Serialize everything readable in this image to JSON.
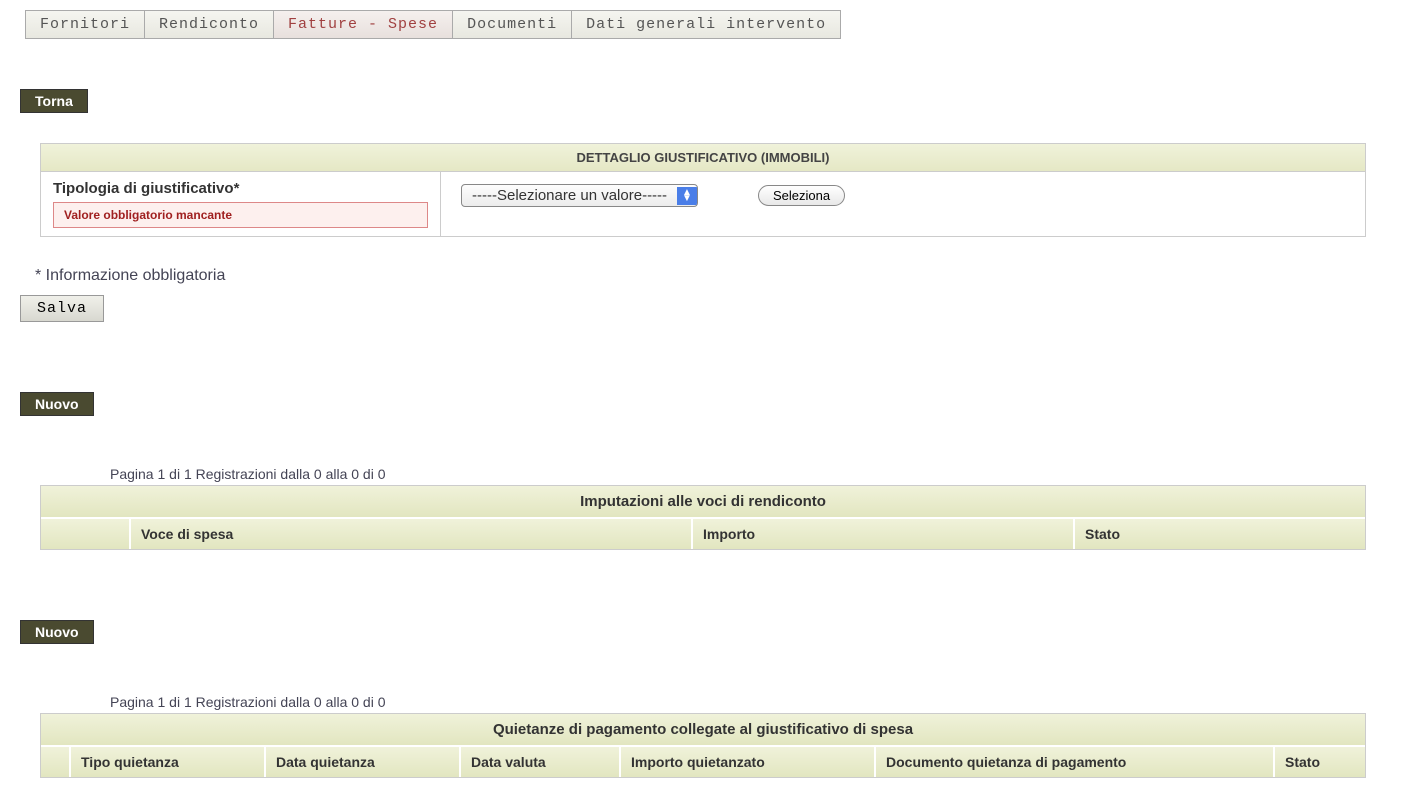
{
  "tabs": {
    "fornitori": "Fornitori",
    "rendiconto": "Rendiconto",
    "fatture_spese": "Fatture - Spese",
    "documenti": "Documenti",
    "dati_generali": "Dati generali intervento"
  },
  "buttons": {
    "torna": "Torna",
    "salva": "Salva",
    "seleziona": "Seleziona",
    "nuovo": "Nuovo"
  },
  "section": {
    "dettaglio_title": "DETTAGLIO GIUSTIFICATIVO (IMMOBILI)"
  },
  "form": {
    "tipologia_label": "Tipologia di giustificativo*",
    "error_message": "Valore obbligatorio mancante",
    "select_placeholder": "-----Selezionare un valore-----"
  },
  "info": {
    "obbligatoria": "* Informazione obbligatoria"
  },
  "table1": {
    "pagination": "Pagina 1 di 1 Registrazioni dalla 0 alla 0 di 0",
    "title": "Imputazioni alle voci di rendiconto",
    "col_voce": "Voce di spesa",
    "col_importo": "Importo",
    "col_stato": "Stato"
  },
  "table2": {
    "pagination": "Pagina 1 di 1 Registrazioni dalla 0 alla 0 di 0",
    "title": "Quietanze di pagamento collegate al giustificativo di spesa",
    "col_tipo": "Tipo quietanza",
    "col_data_q": "Data quietanza",
    "col_data_v": "Data valuta",
    "col_importo": "Importo quietanzato",
    "col_documento": "Documento quietanza di pagamento",
    "col_stato": "Stato"
  }
}
